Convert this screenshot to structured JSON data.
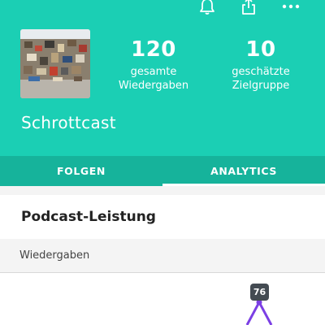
{
  "header": {
    "icons": [
      "bell-icon",
      "share-icon",
      "more-icon"
    ]
  },
  "podcast": {
    "name": "Schrottcast"
  },
  "stats": [
    {
      "value": "120",
      "label_line1": "gesamte",
      "label_line2": "Wiedergaben"
    },
    {
      "value": "10",
      "label_line1": "geschätzte",
      "label_line2": "Zielgruppe"
    }
  ],
  "tabs": [
    {
      "label": "FOLGEN",
      "active": false
    },
    {
      "label": "ANALYTICS",
      "active": true
    }
  ],
  "section": {
    "title": "Podcast-Leistung"
  },
  "metric": {
    "label": "Wiedergaben"
  },
  "chart_data": {
    "type": "line",
    "series": [
      {
        "values": [
          76
        ]
      }
    ],
    "peak_label": "76",
    "line_color": "#7b3fe4"
  },
  "colors": {
    "brand": "#1bcfb4",
    "tab_bar": "#16b39b",
    "badge": "#444b52"
  }
}
